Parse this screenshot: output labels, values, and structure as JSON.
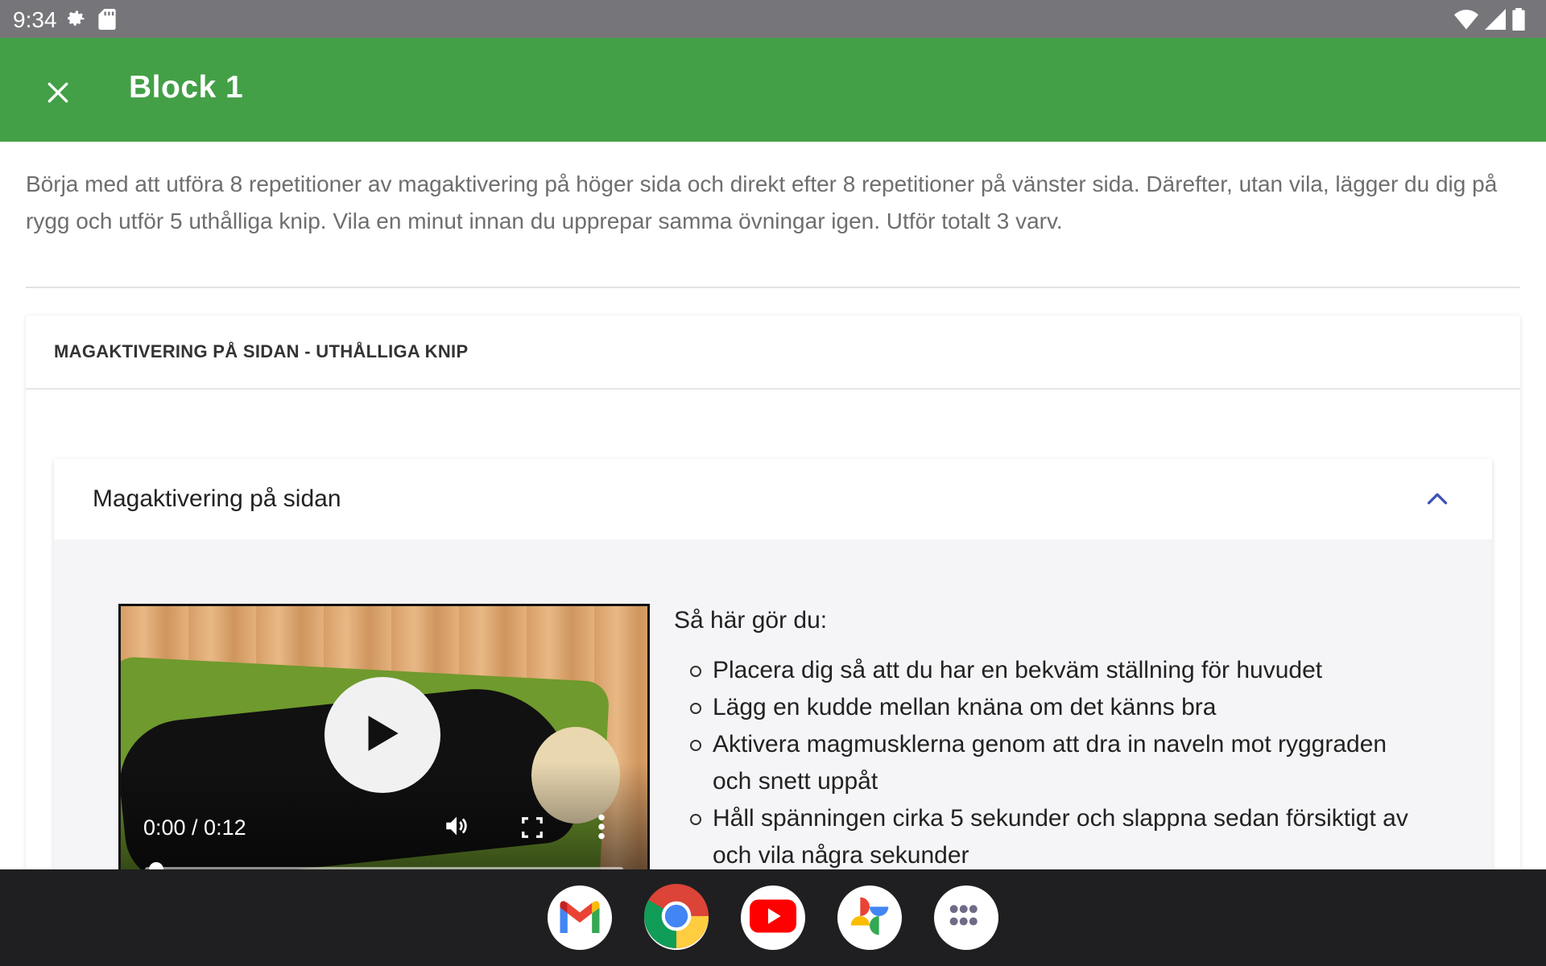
{
  "status_bar": {
    "time": "9:34",
    "left_icons": [
      "settings-icon",
      "sd-card-icon"
    ],
    "right_icons": [
      "wifi-icon",
      "signal-icon",
      "battery-icon"
    ]
  },
  "app_bar": {
    "title": "Block 1",
    "close_icon": "close-icon",
    "background_color": "#43a047"
  },
  "intro": {
    "text": "Börja med att utföra 8 repetitioner av magaktivering på höger sida och direkt efter 8 repetitioner på vänster sida. Därefter, utan vila, lägger du dig på rygg och utför 5 uthålliga knip. Vila en minut innan du upprepar samma övningar igen. Utför totalt 3 varv."
  },
  "exercise_group": {
    "title": "MAGAKTIVERING PÅ SIDAN - UTHÅLLIGA KNIP"
  },
  "exercise": {
    "title": "Magaktivering på sidan",
    "expanded": true,
    "video": {
      "current_time": "0:00",
      "duration": "0:12",
      "time_display": "0:00 / 0:12",
      "progress": 0.0
    },
    "instructions_title": "Så här gör du:",
    "steps": [
      "Placera dig så att du har en bekväm ställning för huvudet",
      "Lägg en kudde mellan knäna om det känns bra",
      "Aktivera magmusklerna genom att dra in naveln mot ryggraden och snett uppåt",
      "Håll spänningen cirka 5 sekunder och slappna sedan försiktigt av och vila några sekunder"
    ]
  },
  "dock": {
    "apps": [
      "gmail-icon",
      "chrome-icon",
      "youtube-icon",
      "photos-icon",
      "app-drawer-icon"
    ]
  },
  "colors": {
    "accent": "#43a047",
    "chevron": "#3f51b5",
    "status_bar": "#767579",
    "nav_bar": "#1f1f21"
  }
}
